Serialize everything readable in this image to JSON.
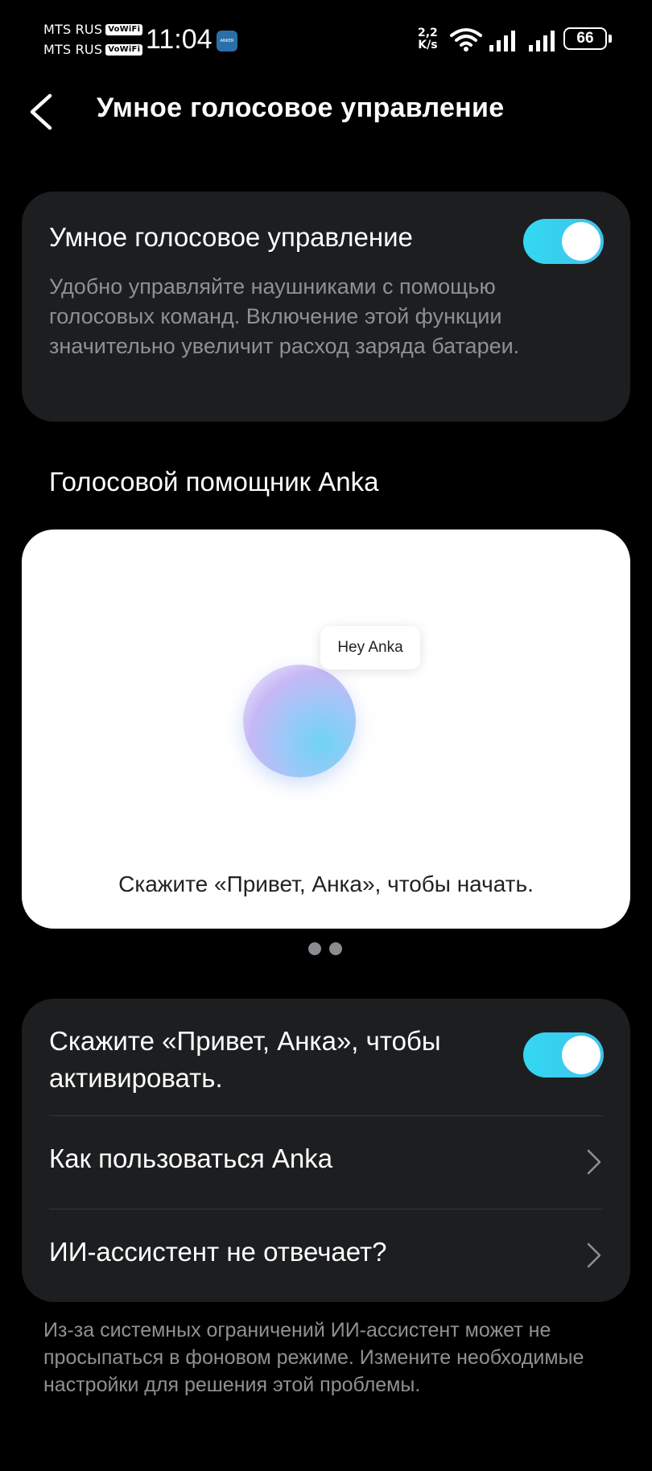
{
  "status_bar": {
    "carrier_1": "MTS RUS",
    "carrier_2": "MTS RUS",
    "vowifi_1": "VoWiFi",
    "vowifi_2": "VoWiFi",
    "time": "11:04",
    "app_badge": "ANKER",
    "net_speed_value": "2,2",
    "net_speed_unit": "K/s",
    "battery": "66"
  },
  "header": {
    "title": "Умное голосовое управление"
  },
  "smart_voice": {
    "title": "Умное голосовое управление",
    "description": "Удобно управляйте наушниками с помощью голосовых команд. Включение этой функции значительно увеличит расход заряда батареи.",
    "enabled": true
  },
  "assistant_section": {
    "title": "Голосовой помощник Anka"
  },
  "preview": {
    "bubble_text": "Hey Anka",
    "caption": "Скажите «Привет, Анка», чтобы начать.",
    "page_count": 2
  },
  "settings_list": {
    "activate_label": "Скажите «Привет, Анка», чтобы активировать.",
    "activate_enabled": true,
    "how_to_use_label": "Как пользоваться Anka",
    "not_responding_label": "ИИ-ассистент не отвечает?"
  },
  "footnote": "Из-за системных ограничений ИИ-ассистент может не просыпаться в фоновом режиме. Измените необходимые настройки для решения этой проблемы.",
  "colors": {
    "background": "#000000",
    "card": "#1c1e20",
    "accent": "#33d8f0",
    "secondary_text": "#8e9194"
  }
}
